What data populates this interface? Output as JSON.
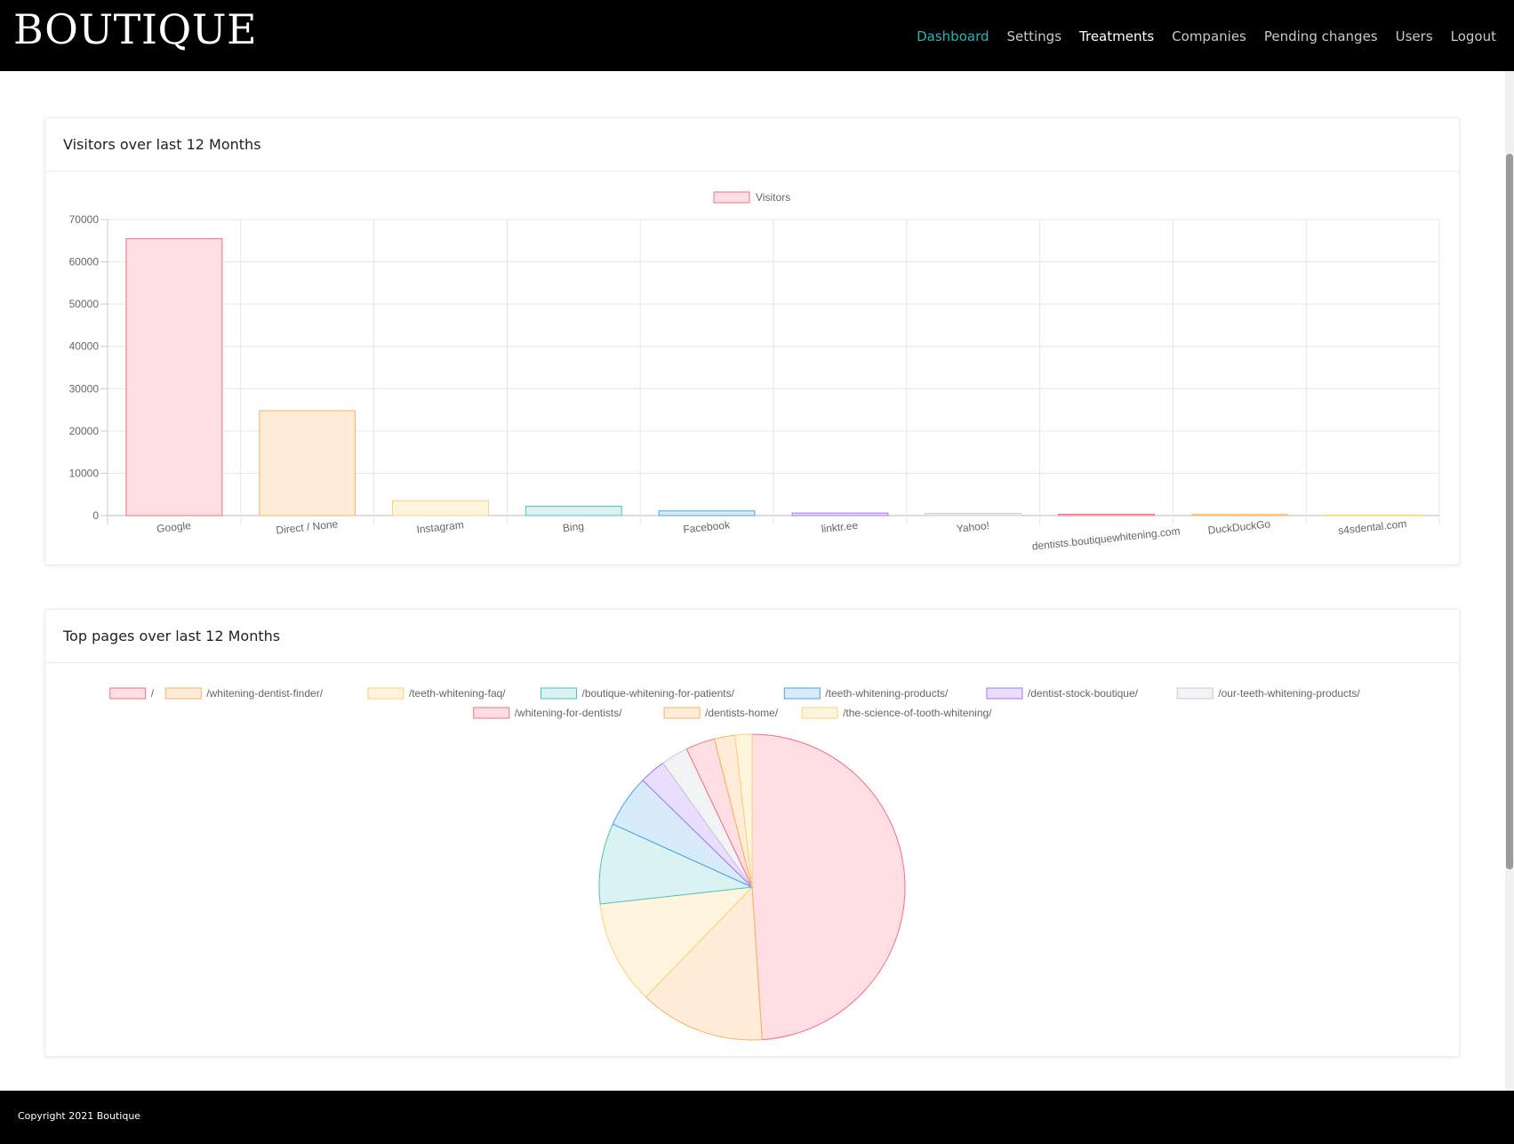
{
  "brand": {
    "logo_text": "BOUTIQUE"
  },
  "nav": {
    "items": [
      {
        "label": "Dashboard",
        "state": "active"
      },
      {
        "label": "Settings",
        "state": "normal"
      },
      {
        "label": "Treatments",
        "state": "highlight"
      },
      {
        "label": "Companies",
        "state": "normal"
      },
      {
        "label": "Pending changes",
        "state": "normal"
      },
      {
        "label": "Users",
        "state": "normal"
      },
      {
        "label": "Logout",
        "state": "normal"
      }
    ]
  },
  "colors": {
    "accent": "#2ab3b8",
    "palette": [
      {
        "fill": "#ffdee4",
        "stroke": "#f56c8a"
      },
      {
        "fill": "#ffecd9",
        "stroke": "#f9b25e"
      },
      {
        "fill": "#fff4de",
        "stroke": "#fad27a"
      },
      {
        "fill": "#dbf2f2",
        "stroke": "#4fc0c0"
      },
      {
        "fill": "#d8ebfa",
        "stroke": "#47a3e6"
      },
      {
        "fill": "#e9dffd",
        "stroke": "#a279f6"
      },
      {
        "fill": "#f2f3f5",
        "stroke": "#c9cbcf"
      }
    ]
  },
  "cards": {
    "visitors": {
      "title": "Visitors over last 12 Months"
    },
    "pages": {
      "title": "Top pages over last 12 Months"
    }
  },
  "chart_data": [
    {
      "type": "bar",
      "title": "",
      "series": [
        {
          "name": "Visitors",
          "values": [
            65500,
            24800,
            3500,
            2200,
            1100,
            600,
            500,
            300,
            250,
            150
          ]
        }
      ],
      "categories": [
        "Google",
        "Direct / None",
        "Instagram",
        "Bing",
        "Facebook",
        "linktr.ee",
        "Yahoo!",
        "dentists.boutiquewhitening.com",
        "DuckDuckGo",
        "s4sdental.com"
      ],
      "ylim": [
        0,
        70000
      ],
      "yticks": [
        "0",
        "10000",
        "20000",
        "30000",
        "40000",
        "50000",
        "60000",
        "70000"
      ],
      "grid": true,
      "legend": "top"
    },
    {
      "type": "pie",
      "labels": [
        "/",
        "/whitening-dentist-finder/",
        "/teeth-whitening-faq/",
        "/boutique-whitening-for-patients/",
        "/teeth-whitening-products/",
        "/dentist-stock-boutique/",
        "/our-teeth-whitening-products/",
        "/whitening-for-dentists/",
        "/dentists-home/",
        "/the-science-of-tooth-whitening/"
      ],
      "values": [
        49.4,
        13.4,
        11.1,
        8.6,
        5.6,
        2.8,
        2.9,
        3.1,
        2.2,
        1.8
      ],
      "legend": "top"
    }
  ],
  "footer": {
    "copyright": "Copyright 2021 Boutique"
  }
}
